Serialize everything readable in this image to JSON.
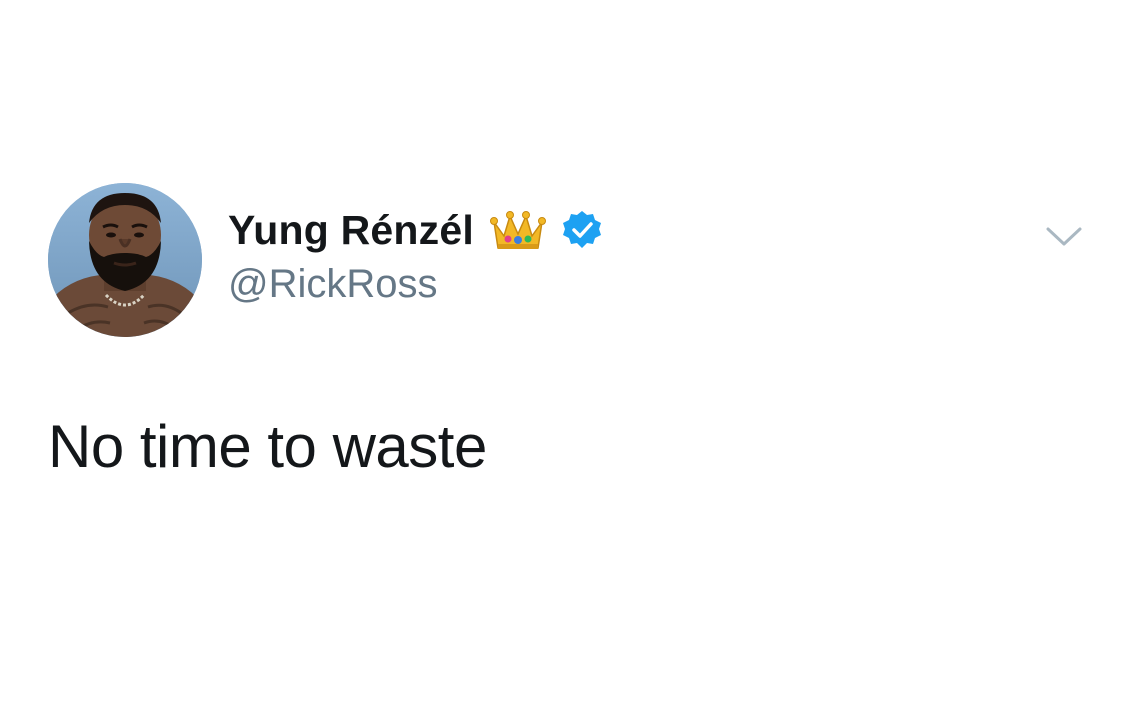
{
  "tweet": {
    "author": {
      "display_name": "Yung Rénzél",
      "handle": "@RickRoss",
      "avatar": "profile-photo",
      "name_emoji_icon": "crown-icon",
      "verified_icon": "verified-badge-icon"
    },
    "text": "No time to waste",
    "menu_icon": "chevron-down-icon"
  },
  "colors": {
    "name": "#14171a",
    "handle": "#657786",
    "text": "#14171a",
    "verified": "#1da1f2",
    "chevron": "#aab8c2",
    "background": "#ffffff"
  }
}
